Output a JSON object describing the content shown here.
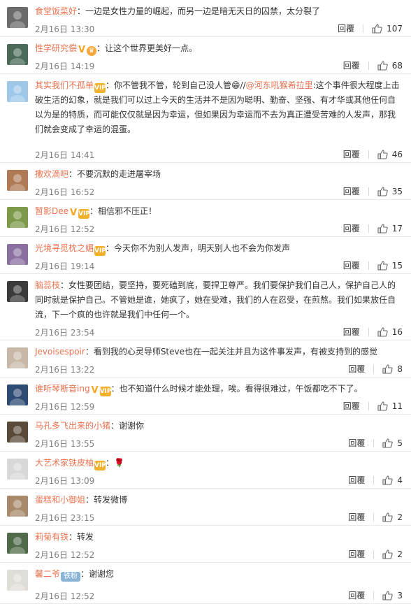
{
  "comments": [
    {
      "user": "食堂饭菜好",
      "badges": [],
      "text": "：一边是女性力量的崛起，而另一边是暗无天日的囚禁，太分裂了",
      "time": "2月16日 13:30",
      "reply": "回覆",
      "likes": "107",
      "avatar_color": "#6b6b6b"
    },
    {
      "user": "性学研究偿",
      "badges": [
        "v",
        "crown"
      ],
      "text": "：让这个世界更美好一点。",
      "time": "2月16日 14:19",
      "reply": "回覆",
      "likes": "68",
      "avatar_color": "#4a6a5a"
    },
    {
      "user": "其实我们不孤单",
      "badges": [
        "member"
      ],
      "text": "：你不管我不管，轮到自己没人管😁//@河东吼猴希拉里:这个事件很大程度上击破生活的幻象，就是我们可以过上今天的生活并不是因为聪明、勤奋、坚强、有才华或其他任何自以为是的特质，而可能仅仅就是因为幸运，但如果因为幸运而不去为真正遭受苦难的人发声，那我们就会变成了幸运的混蛋。",
      "mention": "@河东吼猴希拉里",
      "time": "2月16日 14:41",
      "reply": "回覆",
      "likes": "46",
      "avatar_color": "#9ec7e8"
    },
    {
      "user": "撒欢滴吧",
      "badges": [],
      "text": "：不要沉默的走进屠宰场",
      "time": "2月16日 16:52",
      "reply": "回覆",
      "likes": "35",
      "avatar_color": "#b07a55"
    },
    {
      "user": "暂影Dee",
      "badges": [
        "v",
        "member"
      ],
      "text": "：相信邪不压正！",
      "time": "2月16日 12:52",
      "reply": "回覆",
      "likes": "17",
      "avatar_color": "#7d9a4a"
    },
    {
      "user": "光境寻觅枕之媚",
      "badges": [
        "member"
      ],
      "text": "：今天你不为别人发声，明天别人也不会为你发声",
      "time": "2月16日 19:14",
      "reply": "回覆",
      "likes": "15",
      "avatar_color": "#8a6fa0"
    },
    {
      "user": "脑蕊枝",
      "badges": [],
      "text": "：女性要团结，要坚持，要死磕到底，要捍卫尊严。我们要保护我们自己人，保护自己人的同时就是保护自己。不管她是谁，她疯了，她在受难，我们的人在忍受，在煎熬。我们如果放任自流，下一个疯的也许就是我们中任何一个。",
      "time": "2月16日 23:54",
      "reply": "回覆",
      "likes": "16",
      "avatar_color": "#3b3b3b"
    },
    {
      "user": "Jevoisespoir",
      "badges": [],
      "text": "：看到我的心灵导师Steve也在一起关注并且为这件事发声，有被支持到的感觉",
      "time": "2月16日 13:22",
      "reply": "回覆",
      "likes": "8",
      "avatar_color": "#c9b8a8"
    },
    {
      "user": "谁听琴断音ing",
      "badges": [
        "v",
        "member"
      ],
      "text": "：也不知道什么时候才能处理，唉。看得很难过，午饭都吃不下了。",
      "time": "2月16日 12:59",
      "reply": "回覆",
      "likes": "11",
      "avatar_color": "#2e4b73"
    },
    {
      "user": "马孔多飞出来的小猪",
      "badges": [],
      "text": "：谢谢你",
      "time": "2月16日 13:55",
      "reply": "回覆",
      "likes": "5",
      "avatar_color": "#5a4a3a"
    },
    {
      "user": "大艺术家铁皮柚",
      "badges": [
        "member"
      ],
      "text": "：🌹",
      "time": "2月16日 13:09",
      "reply": "回覆",
      "likes": "4",
      "avatar_color": "#d8d8d8"
    },
    {
      "user": "蛋糕和小御姐",
      "badges": [],
      "text": "：转发微博",
      "time": "2月16日 23:15",
      "reply": "回覆",
      "likes": "2",
      "avatar_color": "#a88a6a"
    },
    {
      "user": "莉菊有铁",
      "badges": [],
      "text": "：转发",
      "time": "2月16日 12:52",
      "reply": "回覆",
      "likes": "2",
      "avatar_color": "#4f6b4a"
    },
    {
      "user": "馨二爷",
      "badges": [
        "tag"
      ],
      "tag_label": "铁粉",
      "text": "：谢谢您",
      "time": "2月16日 12:52",
      "reply": "回覆",
      "likes": "3",
      "avatar_color": "#e0dcd8"
    }
  ]
}
